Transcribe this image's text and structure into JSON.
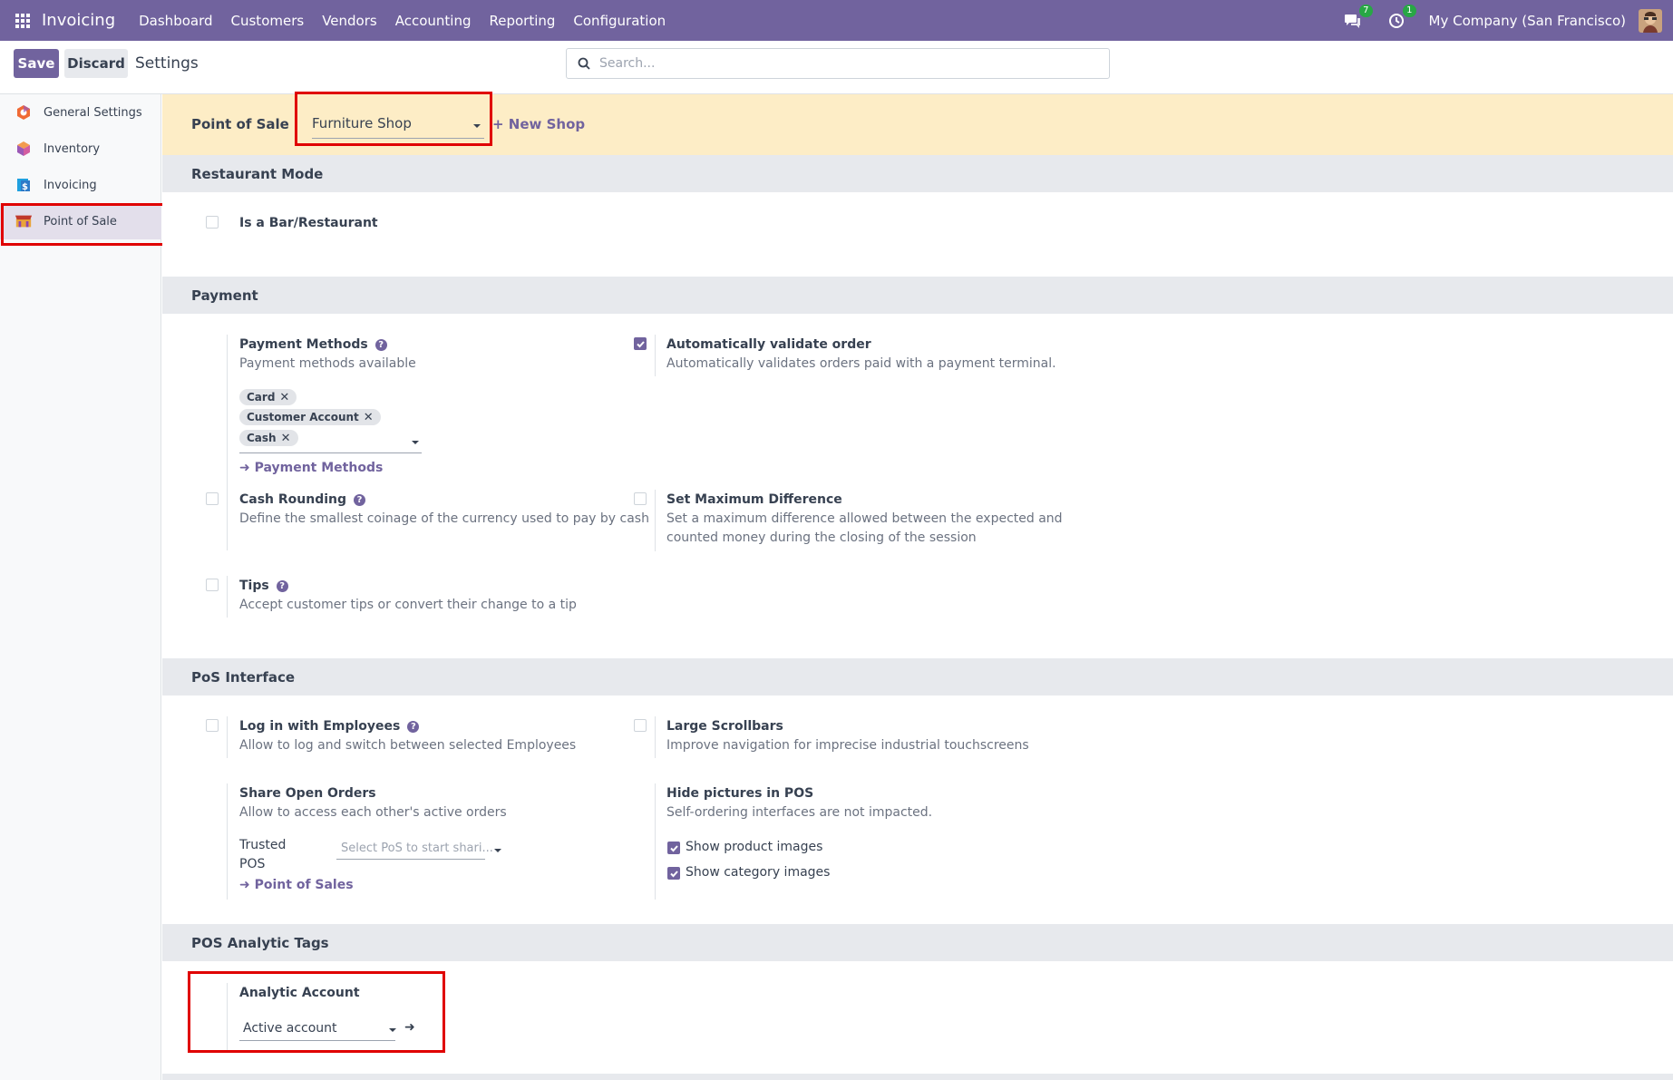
{
  "navbar": {
    "brand": "Invoicing",
    "menu": [
      "Dashboard",
      "Customers",
      "Vendors",
      "Accounting",
      "Reporting",
      "Configuration"
    ],
    "messages_badge": "7",
    "activities_badge": "1",
    "company": "My Company (San Francisco)",
    "color": "#71639e"
  },
  "control": {
    "save": "Save",
    "discard": "Discard",
    "title": "Settings",
    "search_placeholder": "Search..."
  },
  "sidebar": {
    "items": [
      {
        "label": "General Settings",
        "icon": "general-settings-icon"
      },
      {
        "label": "Inventory",
        "icon": "inventory-icon"
      },
      {
        "label": "Invoicing",
        "icon": "invoicing-icon"
      },
      {
        "label": "Point of Sale",
        "icon": "point-of-sale-icon",
        "active": true
      }
    ]
  },
  "pos_bar": {
    "label": "Point of Sale",
    "selected_shop": "Furniture Shop",
    "new_shop": "+ New Shop"
  },
  "restaurant": {
    "header": "Restaurant Mode",
    "bar_restaurant": {
      "title": "Is a Bar/Restaurant",
      "checked": false
    }
  },
  "payment": {
    "header": "Payment",
    "methods": {
      "title": "Payment Methods",
      "desc": "Payment methods available",
      "tags": [
        "Card",
        "Customer Account",
        "Cash"
      ],
      "link": "Payment Methods"
    },
    "auto_validate": {
      "title": "Automatically validate order",
      "desc": "Automatically validates orders paid with a payment terminal.",
      "checked": true
    },
    "cash_rounding": {
      "title": "Cash Rounding",
      "desc": "Define the smallest coinage of the currency used to pay by cash",
      "checked": false
    },
    "max_difference": {
      "title": "Set Maximum Difference",
      "desc_line1": "Set a maximum difference allowed between the expected and",
      "desc_line2": "counted money during the closing of the session",
      "checked": false
    },
    "tips": {
      "title": "Tips",
      "desc": "Accept customer tips or convert their change to a tip",
      "checked": false
    }
  },
  "interface": {
    "header": "PoS Interface",
    "employees": {
      "title": "Log in with Employees",
      "desc": "Allow to log and switch between selected Employees",
      "checked": false
    },
    "scrollbars": {
      "title": "Large Scrollbars",
      "desc": "Improve navigation for imprecise industrial touchscreens",
      "checked": false
    },
    "share_orders": {
      "title": "Share Open Orders",
      "desc": "Allow to access each other's active orders",
      "trusted_label_1": "Trusted",
      "trusted_label_2": "POS",
      "trusted_placeholder": "Select PoS to start shari...",
      "link": "Point of Sales"
    },
    "hide_pictures": {
      "title": "Hide pictures in POS",
      "desc": "Self-ordering interfaces are not impacted.",
      "show_product": "Show product images",
      "show_category": "Show category images",
      "product_checked": true,
      "category_checked": true
    }
  },
  "analytic": {
    "header": "POS Analytic Tags",
    "title": "Analytic Account",
    "value": "Active account"
  }
}
